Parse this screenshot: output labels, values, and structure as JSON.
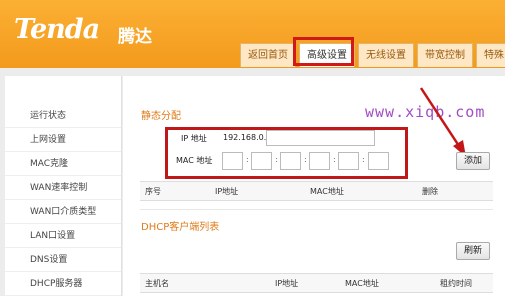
{
  "header": {
    "logo_text": "Tenda",
    "logo_cn": "腾达",
    "tabs": [
      {
        "label": "返回首页",
        "active": false
      },
      {
        "label": "高级设置",
        "active": true
      },
      {
        "label": "无线设置",
        "active": false
      },
      {
        "label": "带宽控制",
        "active": false
      },
      {
        "label": "特殊",
        "active": false
      }
    ]
  },
  "sidebar": {
    "items": [
      {
        "label": "运行状态"
      },
      {
        "label": "上网设置"
      },
      {
        "label": "MAC克隆"
      },
      {
        "label": "WAN速率控制"
      },
      {
        "label": "WAN口介质类型"
      },
      {
        "label": "LAN口设置"
      },
      {
        "label": "DNS设置"
      },
      {
        "label": "DHCP服务器"
      }
    ]
  },
  "main": {
    "static_section_title": "静态分配",
    "watermark": "www.xiqb.com",
    "ip_label": "IP 地址",
    "ip_prefix": "192.168.0.",
    "ip_value": "",
    "mac_label": "MAC 地址",
    "mac_separator": ":",
    "add_button": "添加",
    "static_table_headers": [
      "序号",
      "IP地址",
      "MAC地址",
      "删除"
    ],
    "dhcp_section_title": "DHCP客户端列表",
    "refresh_button": "刷新",
    "dhcp_table_headers": [
      "主机名",
      "IP地址",
      "MAC地址",
      "租约时间"
    ]
  },
  "colors": {
    "header_orange": "#f39a1c",
    "highlight_red": "#d01919",
    "section_orange": "#e07b1a",
    "watermark_purple": "#a34dc4"
  }
}
